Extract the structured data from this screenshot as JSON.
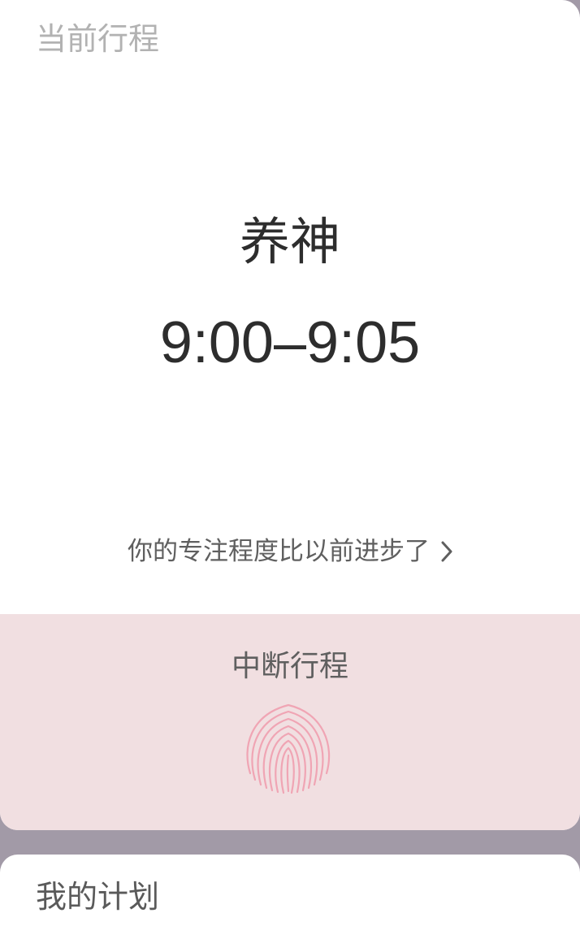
{
  "current": {
    "section_title": "当前行程",
    "task_name": "养神",
    "time_range": "9:00–9:05",
    "progress_message": "你的专注程度比以前进步了"
  },
  "interrupt": {
    "label": "中断行程",
    "icon": "fingerprint-icon"
  },
  "plan": {
    "section_title": "我的计划"
  },
  "colors": {
    "background": "#a29aa7",
    "card": "#ffffff",
    "interrupt_panel": "#f1dfe1",
    "fingerprint": "#f0a5b4",
    "primary_text": "#2d2d2d",
    "muted_text": "#b2b2b2"
  }
}
